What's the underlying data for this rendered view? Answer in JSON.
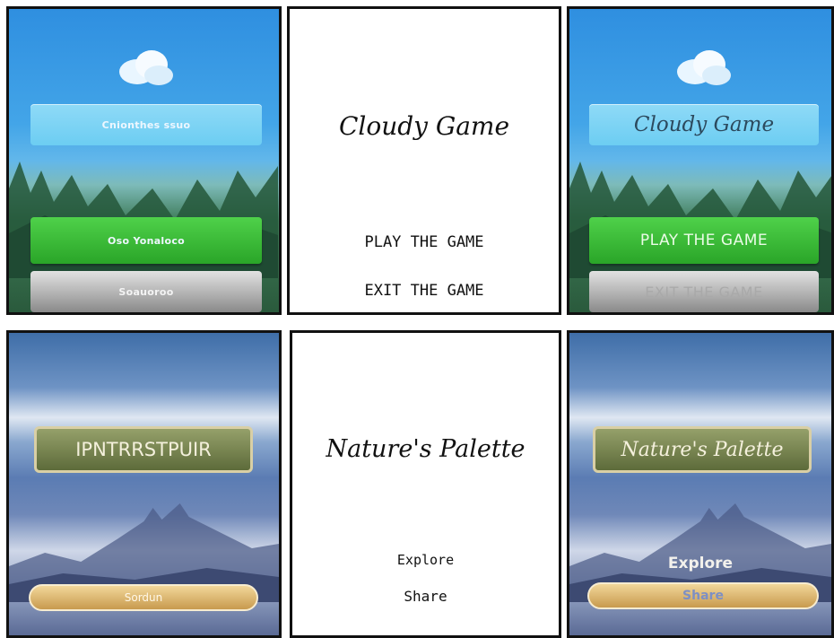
{
  "panels": {
    "cloudy_generated": {
      "title_garbled": "Cnionthes ssuo",
      "play_garbled": "Oso Yonaloco",
      "exit_garbled": "Soauoroo"
    },
    "cloudy_mockup": {
      "title": "Cloudy Game",
      "play": "PLAY THE GAME",
      "exit": "EXIT THE GAME"
    },
    "cloudy_rendered": {
      "title": "Cloudy Game",
      "play": "PLAY THE GAME",
      "exit": "EXIT THE GAME"
    },
    "nature_generated": {
      "title_garbled": "IPNTRRSTPUIR",
      "pill_garbled": "Sordun"
    },
    "nature_mockup": {
      "title": "Nature's Palette",
      "explore": "Explore",
      "share": "Share"
    },
    "nature_rendered": {
      "title": "Nature's Palette",
      "explore": "Explore",
      "share": "Share"
    }
  },
  "colors": {
    "sky": "#43a5e8",
    "green_button": "#34b832",
    "title_bar": "#7cd3f4",
    "gold_pill": "#ddb56e",
    "plaque": "#7a8650"
  }
}
